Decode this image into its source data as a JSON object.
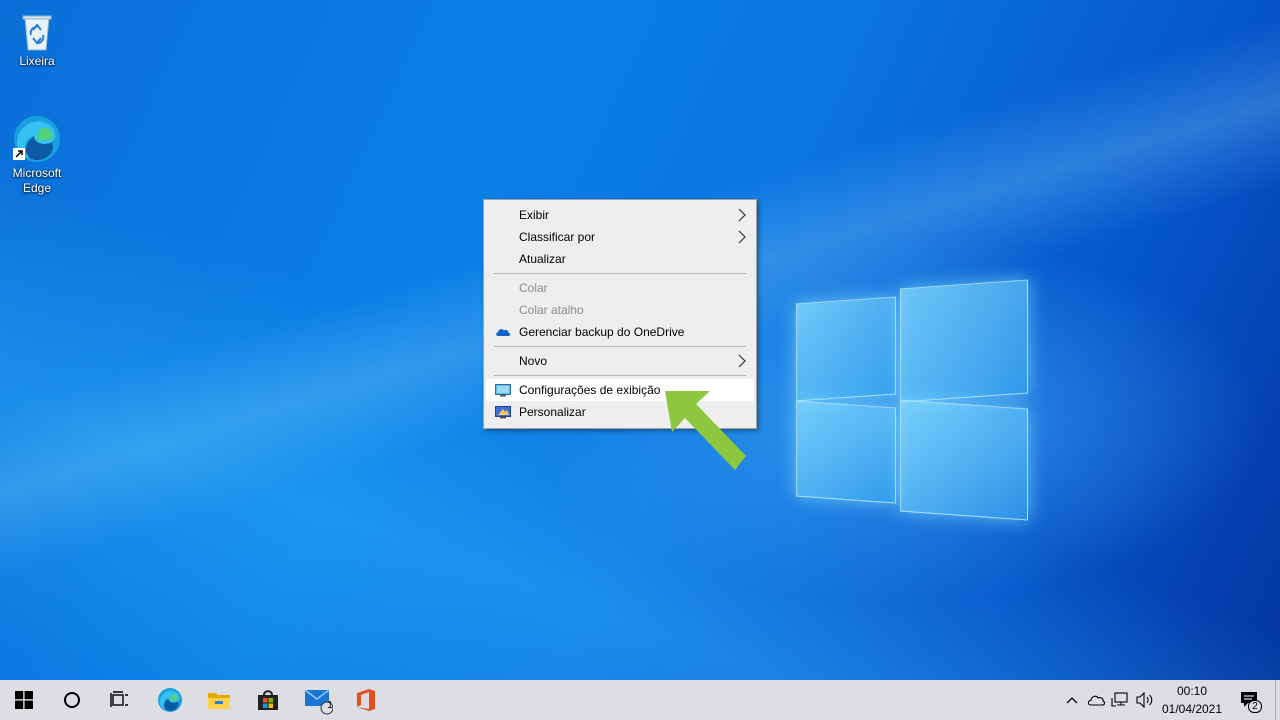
{
  "desktop": {
    "icons": [
      {
        "label": "Lixeira",
        "icon": "recycle-bin-icon"
      },
      {
        "label": "Microsoft\nEdge",
        "icon": "edge-icon"
      }
    ]
  },
  "context_menu": {
    "items": [
      {
        "label": "Exibir",
        "submenu": true
      },
      {
        "label": "Classificar por",
        "submenu": true
      },
      {
        "label": "Atualizar"
      },
      {
        "label": "Colar",
        "disabled": true
      },
      {
        "label": "Colar atalho",
        "disabled": true
      },
      {
        "label": "Gerenciar backup do OneDrive",
        "icon": "onedrive-cloud-icon"
      },
      {
        "label": "Novo",
        "submenu": true
      },
      {
        "label": "Configurações de exibição",
        "icon": "display-settings-icon",
        "highlighted": true
      },
      {
        "label": "Personalizar",
        "icon": "personalize-icon"
      }
    ]
  },
  "annotation": {
    "color": "#8dc63f",
    "icon": "arrow-pointer-icon"
  },
  "taskbar": {
    "items": [
      "start-icon",
      "search-icon",
      "task-view-icon",
      "edge-icon",
      "file-explorer-icon",
      "store-icon",
      "mail-icon",
      "office-icon"
    ],
    "mail_badge": "1"
  },
  "tray": {
    "time": "00:10",
    "date": "01/04/2021",
    "notification_count": "2"
  },
  "colors": {
    "taskbar_bg": "#dcdee4",
    "menu_bg": "#eeeeee",
    "accent": "#0078d7"
  }
}
